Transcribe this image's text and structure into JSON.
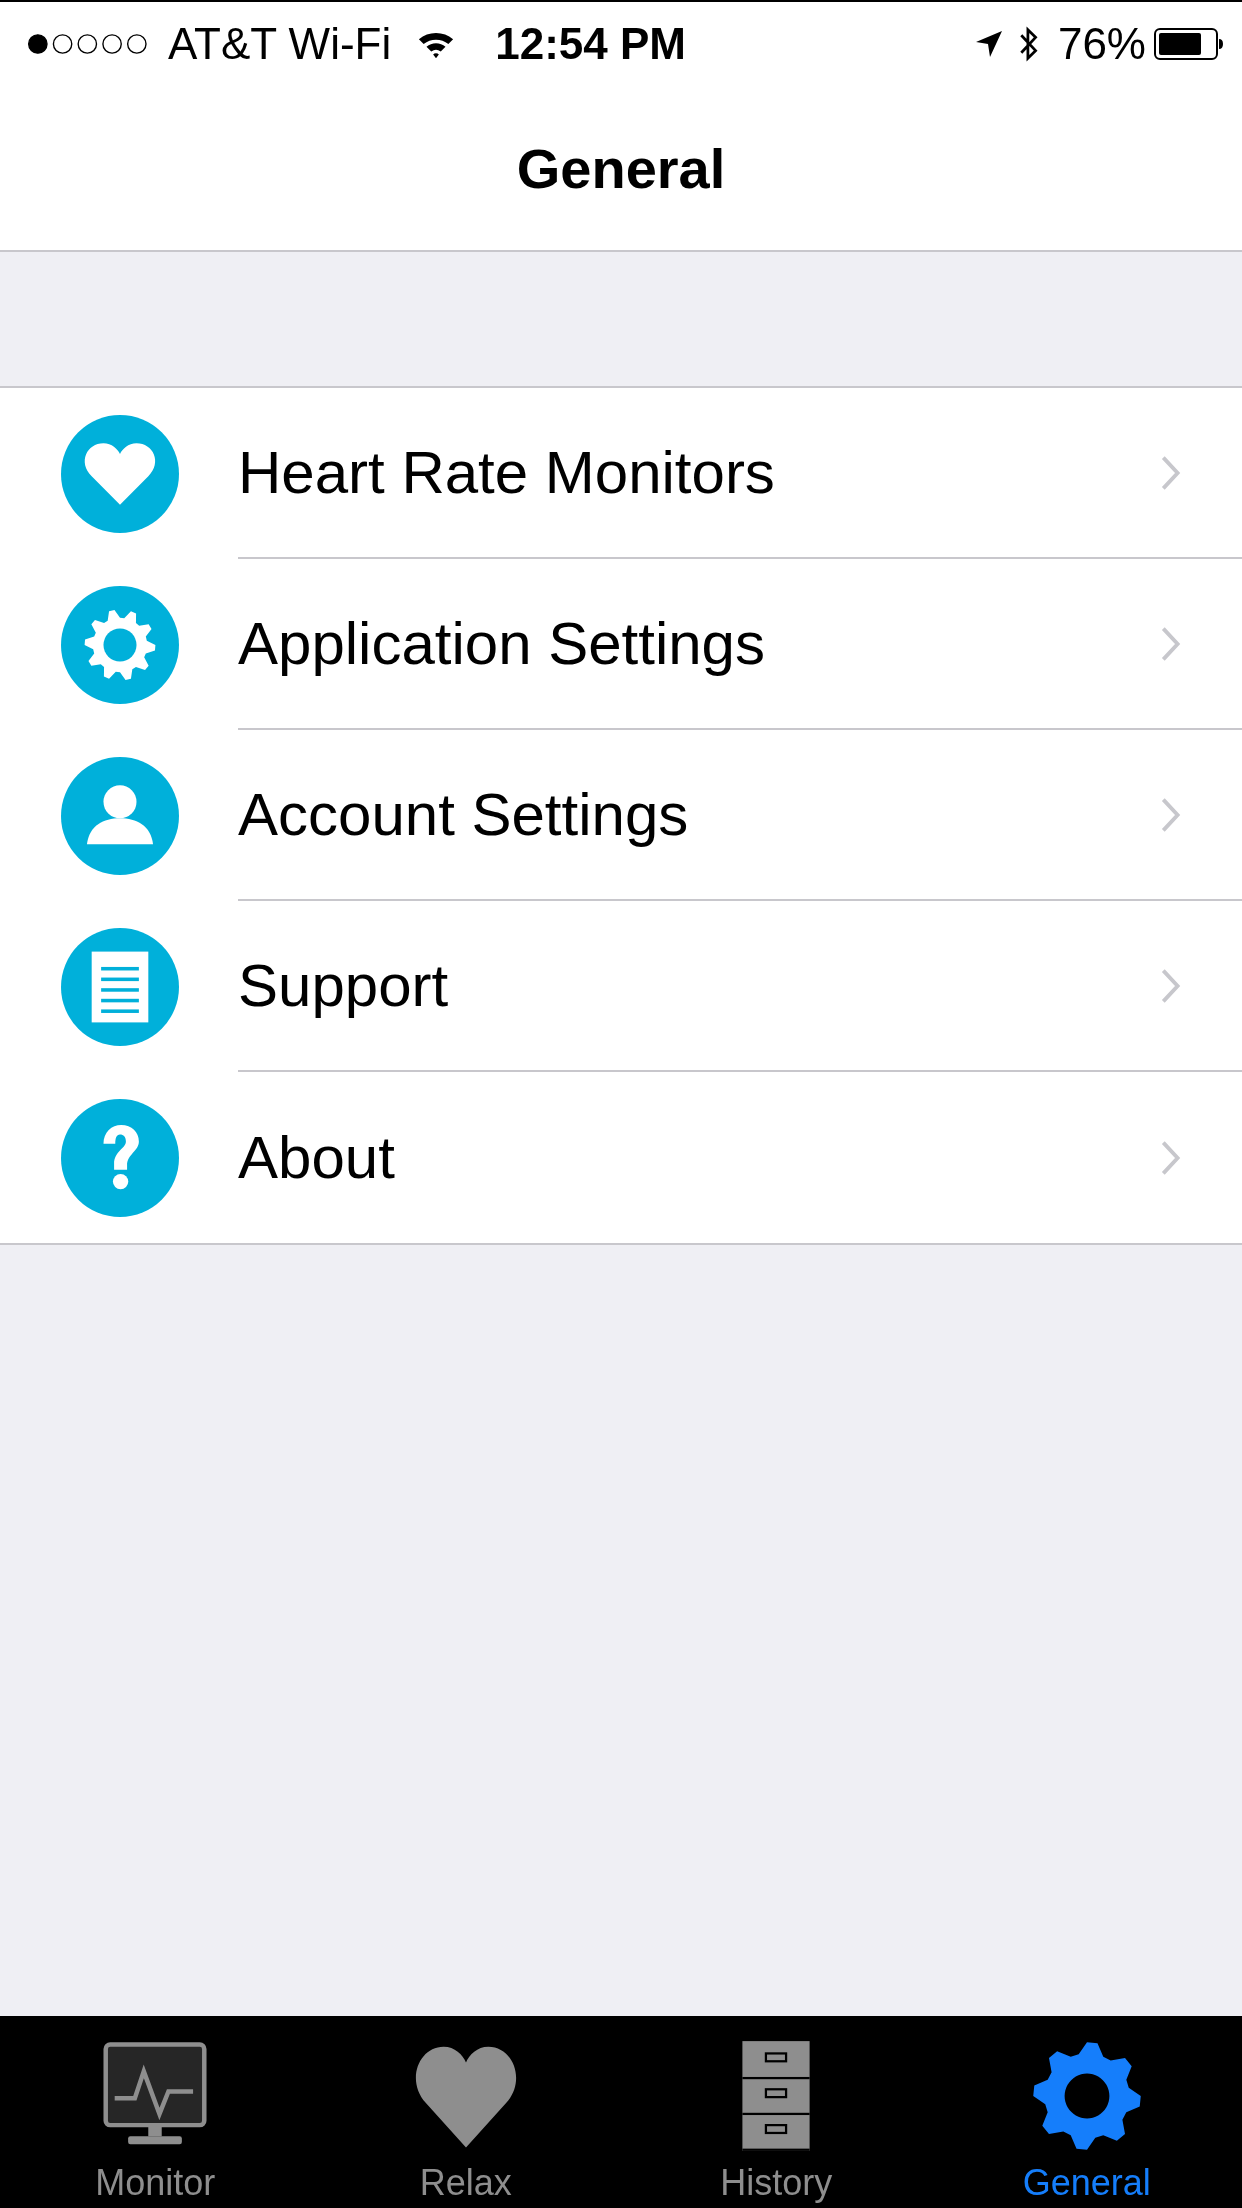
{
  "status_bar": {
    "carrier": "AT&T Wi-Fi",
    "time": "12:54 PM",
    "battery": "76%"
  },
  "nav_bar": {
    "title": "General"
  },
  "menu": [
    {
      "kind": "heart",
      "label": "Heart Rate Monitors"
    },
    {
      "kind": "gear",
      "label": "Application Settings"
    },
    {
      "kind": "person",
      "label": "Account Settings"
    },
    {
      "kind": "document",
      "label": "Support"
    },
    {
      "kind": "question",
      "label": "About"
    }
  ],
  "tab_bar": [
    {
      "kind": "monitor",
      "label": "Monitor",
      "selected": false
    },
    {
      "kind": "heart",
      "label": "Relax",
      "selected": false
    },
    {
      "kind": "cabinet",
      "label": "History",
      "selected": false
    },
    {
      "kind": "gear",
      "label": "General",
      "selected": true
    }
  ]
}
